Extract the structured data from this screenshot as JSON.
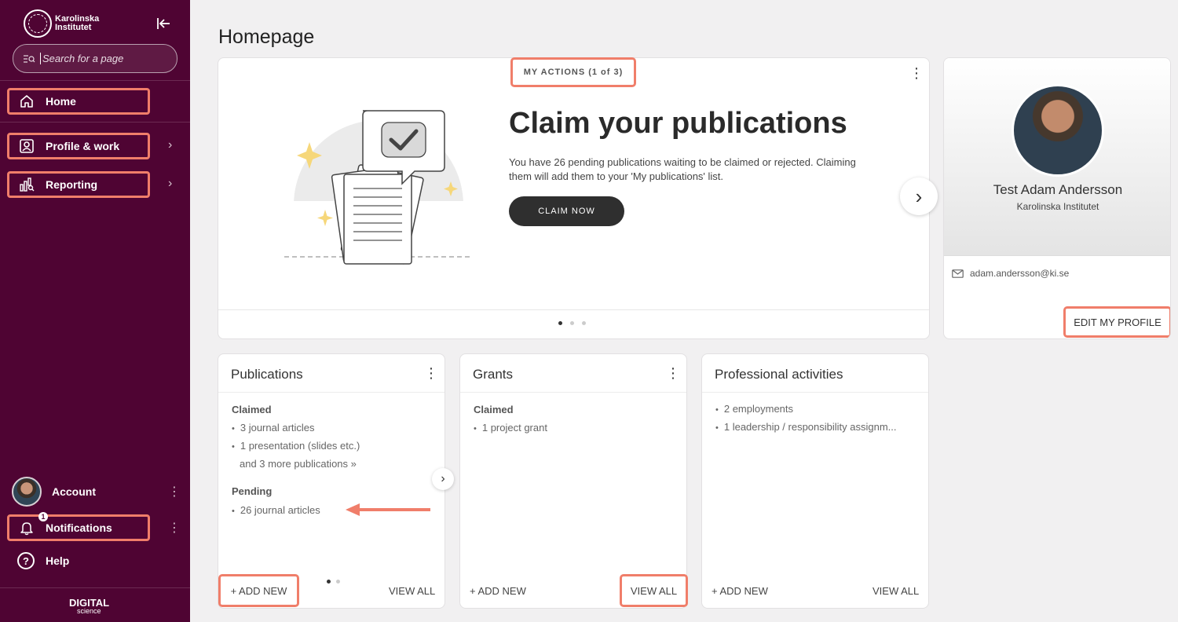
{
  "sidebar": {
    "logo_text": "Karolinska Institutet",
    "search_placeholder": "Search for a page",
    "nav": [
      {
        "label": "Home",
        "icon": "home-icon"
      },
      {
        "label": "Profile & work",
        "icon": "profile-icon"
      },
      {
        "label": "Reporting",
        "icon": "reporting-icon"
      }
    ],
    "account_label": "Account",
    "notifications_label": "Notifications",
    "notifications_count": "1",
    "help_label": "Help",
    "help_icon_glyph": "?",
    "brand_top": "DIGITAL",
    "brand_bottom": "science"
  },
  "page": {
    "title": "Homepage"
  },
  "hero": {
    "tag": "MY ACTIONS (1 of 3)",
    "title": "Claim your publications",
    "description": "You have 26 pending publications waiting to be claimed or rejected. Claiming them will add them to your 'My publications' list.",
    "button": "CLAIM NOW",
    "pager": {
      "total": 3,
      "active": 1
    }
  },
  "profile": {
    "name": "Test Adam Andersson",
    "org": "Karolinska Institutet",
    "email": "adam.andersson@ki.se",
    "edit_label": "EDIT MY PROFILE"
  },
  "publications": {
    "title": "Publications",
    "claimed_heading": "Claimed",
    "claimed_items": [
      "3 journal articles",
      "1 presentation (slides etc.)"
    ],
    "more_link": "and 3 more publications »",
    "pending_heading": "Pending",
    "pending_items": [
      "26 journal articles"
    ],
    "add_label": "+ ADD NEW",
    "view_label": "VIEW ALL"
  },
  "grants": {
    "title": "Grants",
    "claimed_heading": "Claimed",
    "claimed_items": [
      "1 project grant"
    ],
    "add_label": "+ ADD NEW",
    "view_label": "VIEW ALL"
  },
  "activities": {
    "title": "Professional activities",
    "items": [
      "2 employments",
      "1 leadership / responsibility assignm..."
    ],
    "add_label": "+ ADD NEW",
    "view_label": "VIEW ALL"
  },
  "colors": {
    "sidebar": "#4f0433",
    "highlight": "#f07e6a",
    "dark_button": "#2f2f2f",
    "background": "#f1f0f1"
  }
}
